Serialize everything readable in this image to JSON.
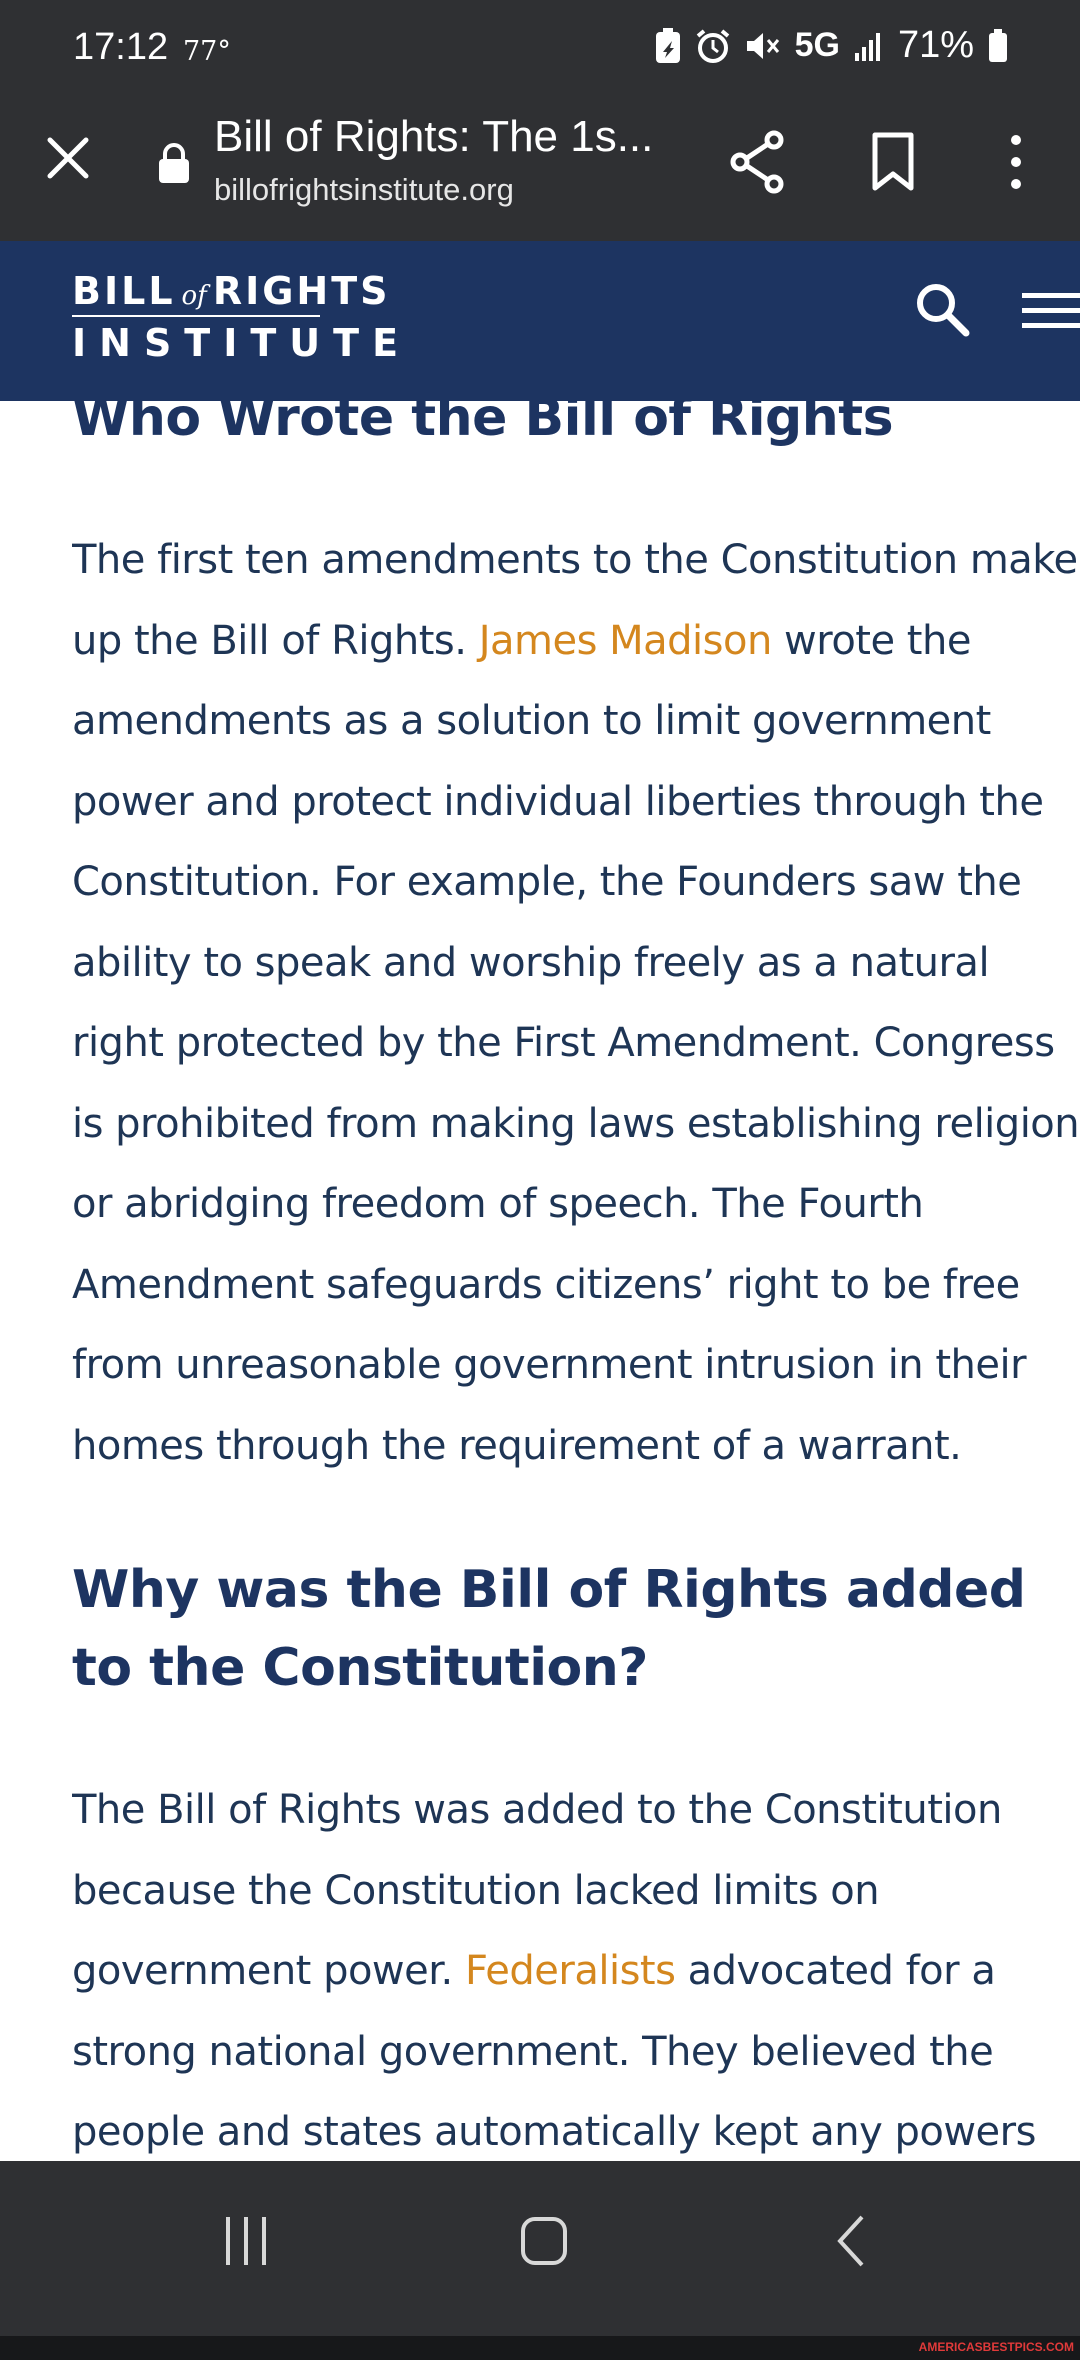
{
  "status_bar": {
    "time": "17:12",
    "temperature": "77°",
    "network": "5G",
    "battery_percent": "71%"
  },
  "browser": {
    "page_title": "Bill of Rights: The 1s...",
    "url": "billofrightsinstitute.org"
  },
  "site_header": {
    "logo_bill": "BILL",
    "logo_of": "of",
    "logo_rights": "RIGHTS",
    "logo_institute": "INSTITUTE"
  },
  "article": {
    "heading_1": "Who Wrote the Bill of Rights",
    "paragraph_1_part1": "The first ten amendments to the Constitution make up the Bill of Rights. ",
    "paragraph_1_link": "James Madison",
    "paragraph_1_part2": " wrote the amendments as a solution to limit government power and protect individual liberties through the Constitution. For example, the Founders saw the ability to speak and worship freely as a natural right protected by the First Amendment. Congress is prohibited from making laws establishing religion or abridging freedom of speech. The Fourth Amendment safeguards citizens’ right to be free from unreasonable government intrusion in their homes through the requirement of a warrant.",
    "heading_2": "Why was the Bill of Rights added to the Constitution?",
    "paragraph_2_part1": "The Bill of Rights was added to the Constitution because the Constitution lacked limits on government power. ",
    "paragraph_2_link": "Federalists",
    "paragraph_2_part2": " advocated for a strong national government. They believed the people and states automatically kept any powers not given to the federal government. Anti-"
  },
  "watermark": "AMERICASBESTPICS.COM",
  "colors": {
    "chrome_bg": "#2f3033",
    "site_header_bg": "#1d3461",
    "heading_text": "#1d3461",
    "body_text": "#1e3555",
    "link": "#d4871e"
  }
}
